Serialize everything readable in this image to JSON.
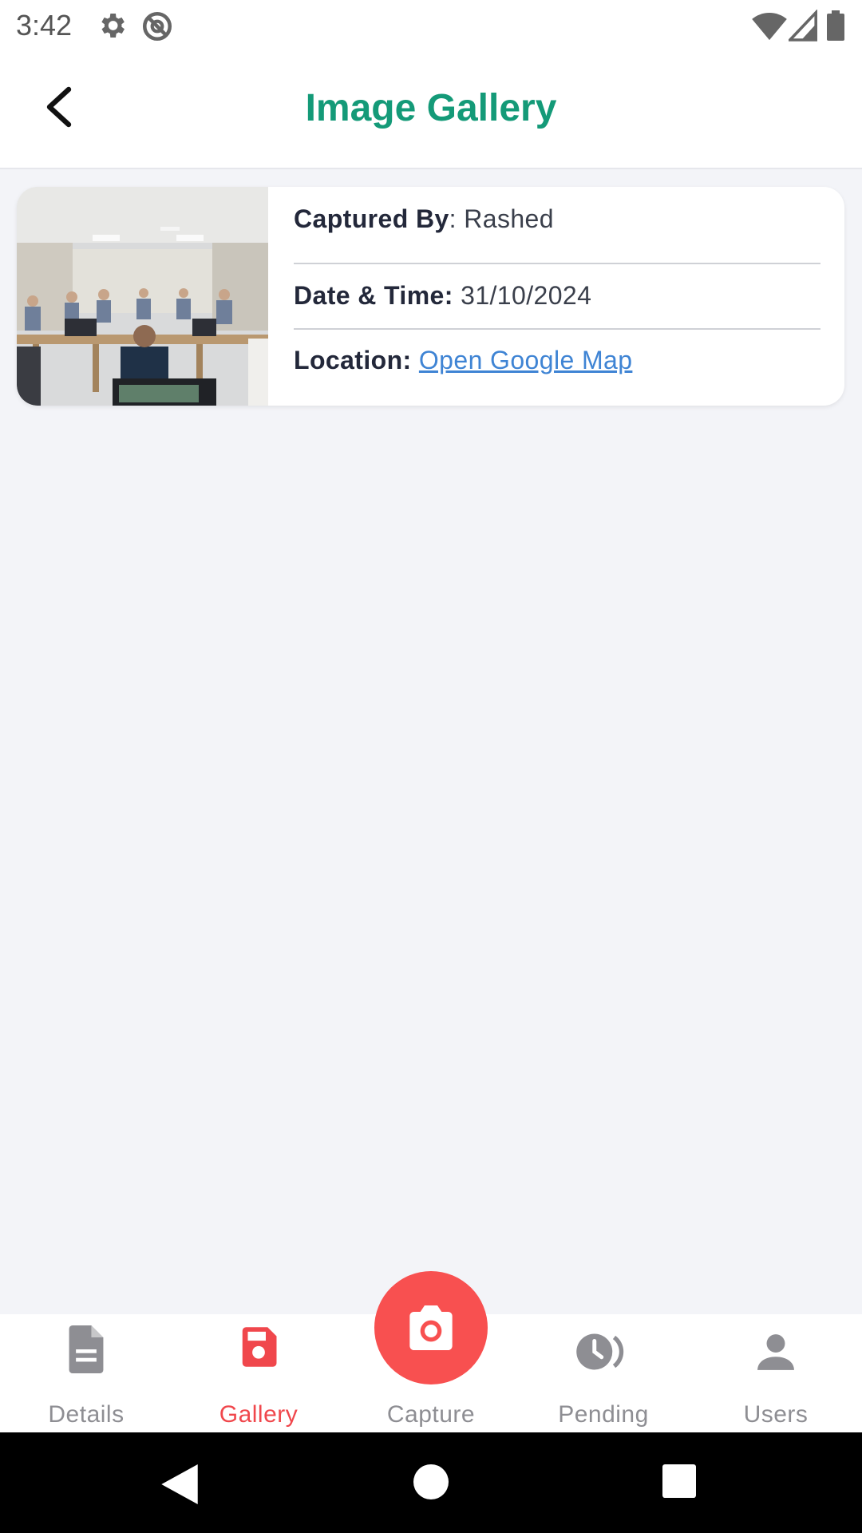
{
  "status_bar": {
    "time": "3:42",
    "icons": [
      "settings-icon",
      "data-saver-icon",
      "wifi-icon",
      "signal-icon",
      "battery-icon"
    ]
  },
  "app_bar": {
    "title": "Image Gallery",
    "back_icon": "chevron-left-icon"
  },
  "gallery": {
    "items": [
      {
        "thumbnail": "classroom-photo",
        "captured_by_label": "Captured By",
        "captured_by_value": "Rashed",
        "datetime_label": "Date & Time:",
        "datetime_value": "31/10/2024",
        "location_label": "Location:",
        "location_link": "Open Google Map"
      }
    ]
  },
  "bottom_nav": {
    "items": [
      {
        "label": "Details",
        "icon": "document-icon",
        "active": false
      },
      {
        "label": "Gallery",
        "icon": "save-icon",
        "active": true
      },
      {
        "label": "Capture",
        "icon": "camera-icon",
        "active": false
      },
      {
        "label": "Pending",
        "icon": "pending-clock-icon",
        "active": false
      },
      {
        "label": "Users",
        "icon": "user-icon",
        "active": false
      }
    ]
  },
  "colors": {
    "accent_green": "#149a78",
    "accent_red": "#f0474c",
    "link_blue": "#3f84d4",
    "inactive_gray": "#8e8e93"
  }
}
